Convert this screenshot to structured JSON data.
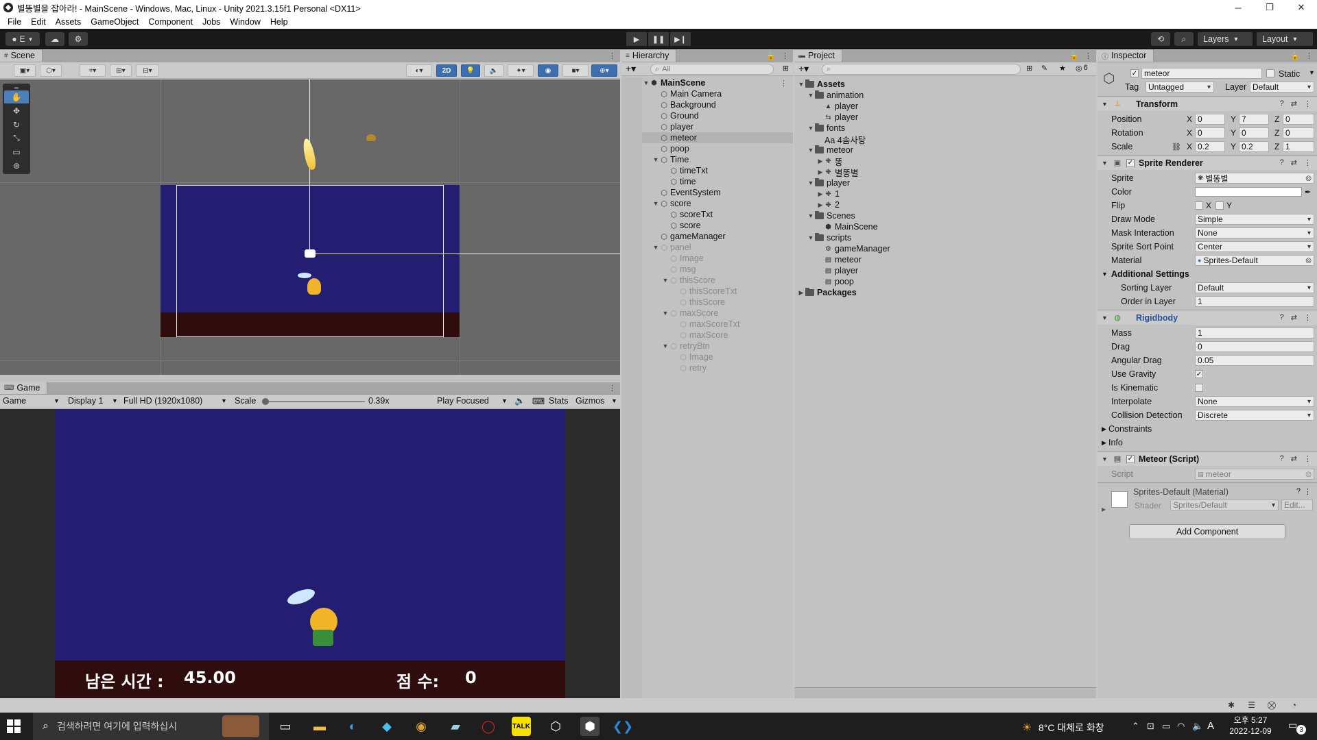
{
  "window": {
    "title": "별똥별을 잡아라! - MainScene - Windows, Mac, Linux - Unity 2021.3.15f1 Personal <DX11>"
  },
  "menu": [
    "File",
    "Edit",
    "Assets",
    "GameObject",
    "Component",
    "Jobs",
    "Window",
    "Help"
  ],
  "toolbar": {
    "account": "E",
    "layers": "Layers",
    "layout": "Layout"
  },
  "scene": {
    "tab": "Scene",
    "mode_2d": "2D"
  },
  "game": {
    "tab": "Game",
    "view_mode": "Game",
    "display": "Display 1",
    "resolution": "Full HD (1920x1080)",
    "scale_label": "Scale",
    "scale_value": "0.39x",
    "play_mode": "Play Focused",
    "stats": "Stats",
    "gizmos": "Gizmos",
    "time_label": "남은 시간 :",
    "time_value": "45.00",
    "score_label": "점 수:",
    "score_value": "0"
  },
  "hierarchy": {
    "tab": "Hierarchy",
    "search_placeholder": "All",
    "items": [
      {
        "label": "MainScene",
        "depth": 0,
        "arrow": "▼",
        "kind": "scene"
      },
      {
        "label": "Main Camera",
        "depth": 1,
        "arrow": "",
        "kind": "obj"
      },
      {
        "label": "Background",
        "depth": 1,
        "arrow": "",
        "kind": "obj"
      },
      {
        "label": "Ground",
        "depth": 1,
        "arrow": "",
        "kind": "obj"
      },
      {
        "label": "player",
        "depth": 1,
        "arrow": "",
        "kind": "obj"
      },
      {
        "label": "meteor",
        "depth": 1,
        "arrow": "",
        "kind": "obj",
        "selected": true
      },
      {
        "label": "poop",
        "depth": 1,
        "arrow": "",
        "kind": "obj"
      },
      {
        "label": "Time",
        "depth": 1,
        "arrow": "▼",
        "kind": "obj"
      },
      {
        "label": "timeTxt",
        "depth": 2,
        "arrow": "",
        "kind": "obj"
      },
      {
        "label": "time",
        "depth": 2,
        "arrow": "",
        "kind": "obj"
      },
      {
        "label": "EventSystem",
        "depth": 1,
        "arrow": "",
        "kind": "obj"
      },
      {
        "label": "score",
        "depth": 1,
        "arrow": "▼",
        "kind": "obj"
      },
      {
        "label": "scoreTxt",
        "depth": 2,
        "arrow": "",
        "kind": "obj"
      },
      {
        "label": "score",
        "depth": 2,
        "arrow": "",
        "kind": "obj"
      },
      {
        "label": "gameManager",
        "depth": 1,
        "arrow": "",
        "kind": "obj"
      },
      {
        "label": "panel",
        "depth": 1,
        "arrow": "▼",
        "kind": "obj",
        "dim": true
      },
      {
        "label": "Image",
        "depth": 2,
        "arrow": "",
        "kind": "obj",
        "dim": true
      },
      {
        "label": "msg",
        "depth": 2,
        "arrow": "",
        "kind": "obj",
        "dim": true
      },
      {
        "label": "thisScore",
        "depth": 2,
        "arrow": "▼",
        "kind": "obj",
        "dim": true
      },
      {
        "label": "thisScoreTxt",
        "depth": 3,
        "arrow": "",
        "kind": "obj",
        "dim": true
      },
      {
        "label": "thisScore",
        "depth": 3,
        "arrow": "",
        "kind": "obj",
        "dim": true
      },
      {
        "label": "maxScore",
        "depth": 2,
        "arrow": "▼",
        "kind": "obj",
        "dim": true
      },
      {
        "label": "maxScoreTxt",
        "depth": 3,
        "arrow": "",
        "kind": "obj",
        "dim": true
      },
      {
        "label": "maxScore",
        "depth": 3,
        "arrow": "",
        "kind": "obj",
        "dim": true
      },
      {
        "label": "retryBtn",
        "depth": 2,
        "arrow": "▼",
        "kind": "obj",
        "dim": true
      },
      {
        "label": "Image",
        "depth": 3,
        "arrow": "",
        "kind": "obj",
        "dim": true
      },
      {
        "label": "retry",
        "depth": 3,
        "arrow": "",
        "kind": "obj",
        "dim": true
      }
    ]
  },
  "project": {
    "tab": "Project",
    "hidden_count": "6",
    "items": [
      {
        "label": "Assets",
        "depth": 0,
        "arrow": "▼",
        "kind": "folder",
        "bold": true
      },
      {
        "label": "animation",
        "depth": 1,
        "arrow": "▼",
        "kind": "folder"
      },
      {
        "label": "player",
        "depth": 2,
        "arrow": "",
        "kind": "anim"
      },
      {
        "label": "player",
        "depth": 2,
        "arrow": "",
        "kind": "animctl"
      },
      {
        "label": "fonts",
        "depth": 1,
        "arrow": "▼",
        "kind": "folder"
      },
      {
        "label": "Aa 4솜사탕",
        "depth": 2,
        "arrow": "",
        "kind": "font"
      },
      {
        "label": "meteor",
        "depth": 1,
        "arrow": "▼",
        "kind": "folder"
      },
      {
        "label": "똥",
        "depth": 2,
        "arrow": "▶",
        "kind": "sprite"
      },
      {
        "label": "별똥별",
        "depth": 2,
        "arrow": "▶",
        "kind": "sprite"
      },
      {
        "label": "player",
        "depth": 1,
        "arrow": "▼",
        "kind": "folder"
      },
      {
        "label": "1",
        "depth": 2,
        "arrow": "▶",
        "kind": "sprite"
      },
      {
        "label": "2",
        "depth": 2,
        "arrow": "▶",
        "kind": "sprite"
      },
      {
        "label": "Scenes",
        "depth": 1,
        "arrow": "▼",
        "kind": "folder"
      },
      {
        "label": "MainScene",
        "depth": 2,
        "arrow": "",
        "kind": "scene"
      },
      {
        "label": "scripts",
        "depth": 1,
        "arrow": "▼",
        "kind": "folder"
      },
      {
        "label": "gameManager",
        "depth": 2,
        "arrow": "",
        "kind": "gear"
      },
      {
        "label": "meteor",
        "depth": 2,
        "arrow": "",
        "kind": "script"
      },
      {
        "label": "player",
        "depth": 2,
        "arrow": "",
        "kind": "script"
      },
      {
        "label": "poop",
        "depth": 2,
        "arrow": "",
        "kind": "script"
      },
      {
        "label": "Packages",
        "depth": 0,
        "arrow": "▶",
        "kind": "folder",
        "bold": true
      }
    ]
  },
  "inspector": {
    "tab": "Inspector",
    "object_name": "meteor",
    "static_label": "Static",
    "tag_label": "Tag",
    "tag_value": "Untagged",
    "layer_label": "Layer",
    "layer_value": "Default",
    "transform": {
      "title": "Transform",
      "position_label": "Position",
      "rotation_label": "Rotation",
      "scale_label": "Scale",
      "position": [
        "0",
        "7",
        "0"
      ],
      "rotation": [
        "0",
        "0",
        "0"
      ],
      "scale": [
        "0.2",
        "0.2",
        "1"
      ]
    },
    "sprite_renderer": {
      "title": "Sprite Renderer",
      "sprite_label": "Sprite",
      "sprite_value": "별똥별",
      "color_label": "Color",
      "flip_label": "Flip",
      "flip_x": "X",
      "flip_y": "Y",
      "draw_mode_label": "Draw Mode",
      "draw_mode_value": "Simple",
      "mask_label": "Mask Interaction",
      "mask_value": "None",
      "sort_point_label": "Sprite Sort Point",
      "sort_point_value": "Center",
      "material_label": "Material",
      "material_value": "Sprites-Default",
      "additional_label": "Additional Settings",
      "sorting_layer_label": "Sorting Layer",
      "sorting_layer_value": "Default",
      "order_label": "Order in Layer",
      "order_value": "1"
    },
    "rigidbody": {
      "title": "Rigidbody",
      "mass_label": "Mass",
      "mass_value": "1",
      "drag_label": "Drag",
      "drag_value": "0",
      "angular_label": "Angular Drag",
      "angular_value": "0.05",
      "gravity_label": "Use Gravity",
      "kinematic_label": "Is Kinematic",
      "interpolate_label": "Interpolate",
      "interpolate_value": "None",
      "collision_label": "Collision Detection",
      "collision_value": "Discrete",
      "constraints_label": "Constraints",
      "info_label": "Info"
    },
    "meteor_script": {
      "title": "Meteor (Script)",
      "script_label": "Script",
      "script_value": "meteor"
    },
    "material": {
      "title": "Sprites-Default (Material)",
      "shader_label": "Shader",
      "shader_value": "Sprites/Default",
      "edit_label": "Edit..."
    },
    "add_component": "Add Component"
  },
  "taskbar": {
    "search_placeholder": "검색하려면 여기에 입력하십시",
    "weather": "8°C  대체로 화창",
    "time": "오후 5:27",
    "date": "2022-12-09",
    "ime": "A",
    "notifications": "3"
  },
  "colors": {
    "game_bg": "#241e73",
    "ground": "#2f0d0d",
    "selection_blue": "#4d7fb8",
    "toolbar_dark": "#191919"
  }
}
